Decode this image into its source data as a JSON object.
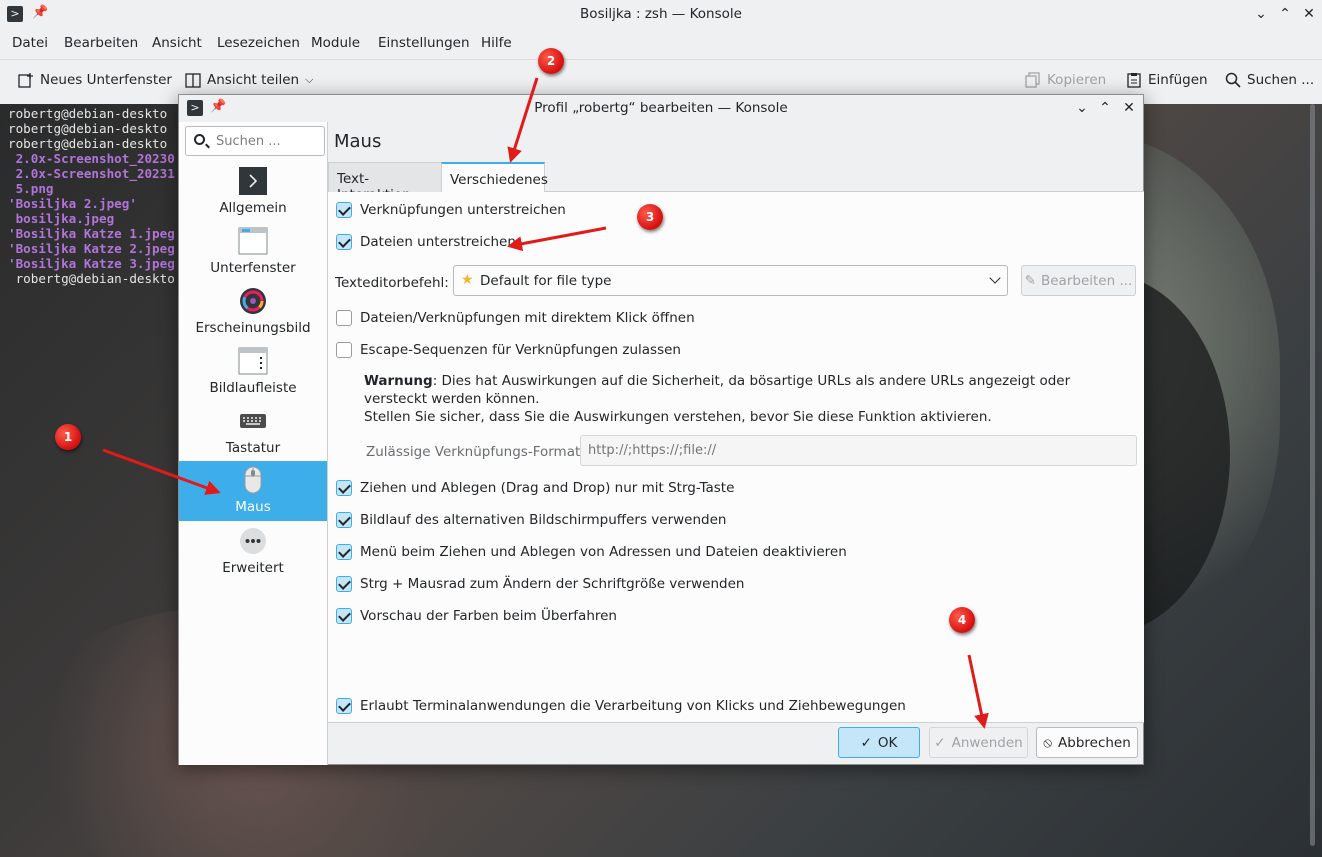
{
  "main_window": {
    "title": "Bosiljka : zsh — Konsole",
    "menu": [
      "Datei",
      "Bearbeiten",
      "Ansicht",
      "Lesezeichen",
      "Module",
      "Einstellungen",
      "Hilfe"
    ],
    "toolbar": {
      "new_tab": "Neues Unterfenster",
      "split_view": "Ansicht teilen",
      "copy": "Kopieren",
      "paste": "Einfügen",
      "find": "Suchen ..."
    }
  },
  "terminal": {
    "lines": [
      {
        "text": "robertg@debian-deskto",
        "kind": "prompt"
      },
      {
        "text": "robertg@debian-deskto",
        "kind": "prompt"
      },
      {
        "text": "robertg@debian-deskto",
        "kind": "prompt"
      },
      {
        "text": " 2.0x-Screenshot_20230",
        "kind": "file"
      },
      {
        "text": " 2.0x-Screenshot_20231",
        "kind": "file"
      },
      {
        "text": " 5.png",
        "kind": "file"
      },
      {
        "text": "'Bosiljka 2.jpeg'",
        "kind": "file"
      },
      {
        "text": " bosiljka.jpeg",
        "kind": "file"
      },
      {
        "text": "'Bosiljka Katze 1.jpeg",
        "kind": "file"
      },
      {
        "text": "'Bosiljka Katze 2.jpeg",
        "kind": "file"
      },
      {
        "text": "'Bosiljka Katze 3.jpeg",
        "kind": "file"
      },
      {
        "text": " robertg@debian-deskto",
        "kind": "prompt"
      }
    ]
  },
  "dialog": {
    "title": "Profil „robertg“ bearbeiten — Konsole",
    "search_placeholder": "Suchen ...",
    "nav": [
      "Allgemein",
      "Unterfenster",
      "Erscheinungsbild",
      "Bildlaufleiste",
      "Tastatur",
      "Maus",
      "Erweitert"
    ],
    "active_nav": "Maus",
    "page_title": "Maus",
    "tabs": [
      "Text-Interaktion",
      "Verschiedenes"
    ],
    "active_tab": "Verschiedenes",
    "options": {
      "underline_links": {
        "label": "Verknüpfungen unterstreichen",
        "checked": true
      },
      "underline_files": {
        "label": "Dateien unterstreichen",
        "checked": true
      },
      "editor_label": "Texteditorbefehl:",
      "editor_value": "Default for file type",
      "edit_button": "Bearbeiten ...",
      "open_direct_click": {
        "label": "Dateien/Verknüpfungen mit direktem Klick öffnen",
        "checked": false
      },
      "escape_sequences": {
        "label": "Escape-Sequenzen für Verknüpfungen zulassen",
        "checked": false
      },
      "warning_bold": "Warnung",
      "warning_text": ": Dies hat Auswirkungen auf die Sicherheit, da bösartige URLs als andere URLs angezeigt oder versteckt werden können.",
      "warning_text2": "Stellen Sie sicher, dass Sie die Auswirkungen verstehen, bevor Sie diese Funktion aktivieren.",
      "formats_label": "Zulässige Verknüpfungs-Formate:",
      "formats_placeholder": "http://;https://;file://",
      "drag_drop_ctrl": {
        "label": "Ziehen und Ablegen (Drag and Drop) nur mit Strg-Taste",
        "checked": true
      },
      "alt_screen_scroll": {
        "label": "Bildlauf des alternativen Bildschirmpuffers verwenden",
        "checked": true
      },
      "disable_dnd_menu": {
        "label": "Menü beim Ziehen und Ablegen von Adressen und Dateien deaktivieren",
        "checked": true
      },
      "ctrl_wheel_zoom": {
        "label": "Strg + Mausrad zum Ändern der Schriftgröße verwenden",
        "checked": true
      },
      "color_preview": {
        "label": "Vorschau der Farben beim Überfahren",
        "checked": true
      },
      "allow_mouse_tracking": {
        "label": "Erlaubt Terminalanwendungen die Verarbeitung von Klicks und Ziehbewegungen",
        "checked": true
      }
    },
    "buttons": {
      "ok": "OK",
      "apply": "Anwenden",
      "cancel": "Abbrechen"
    }
  },
  "annotations": [
    "1",
    "2",
    "3",
    "4"
  ],
  "colors": {
    "accent": "#3daee9",
    "badge": "#d50f0f",
    "file_text": "#b174d8"
  }
}
